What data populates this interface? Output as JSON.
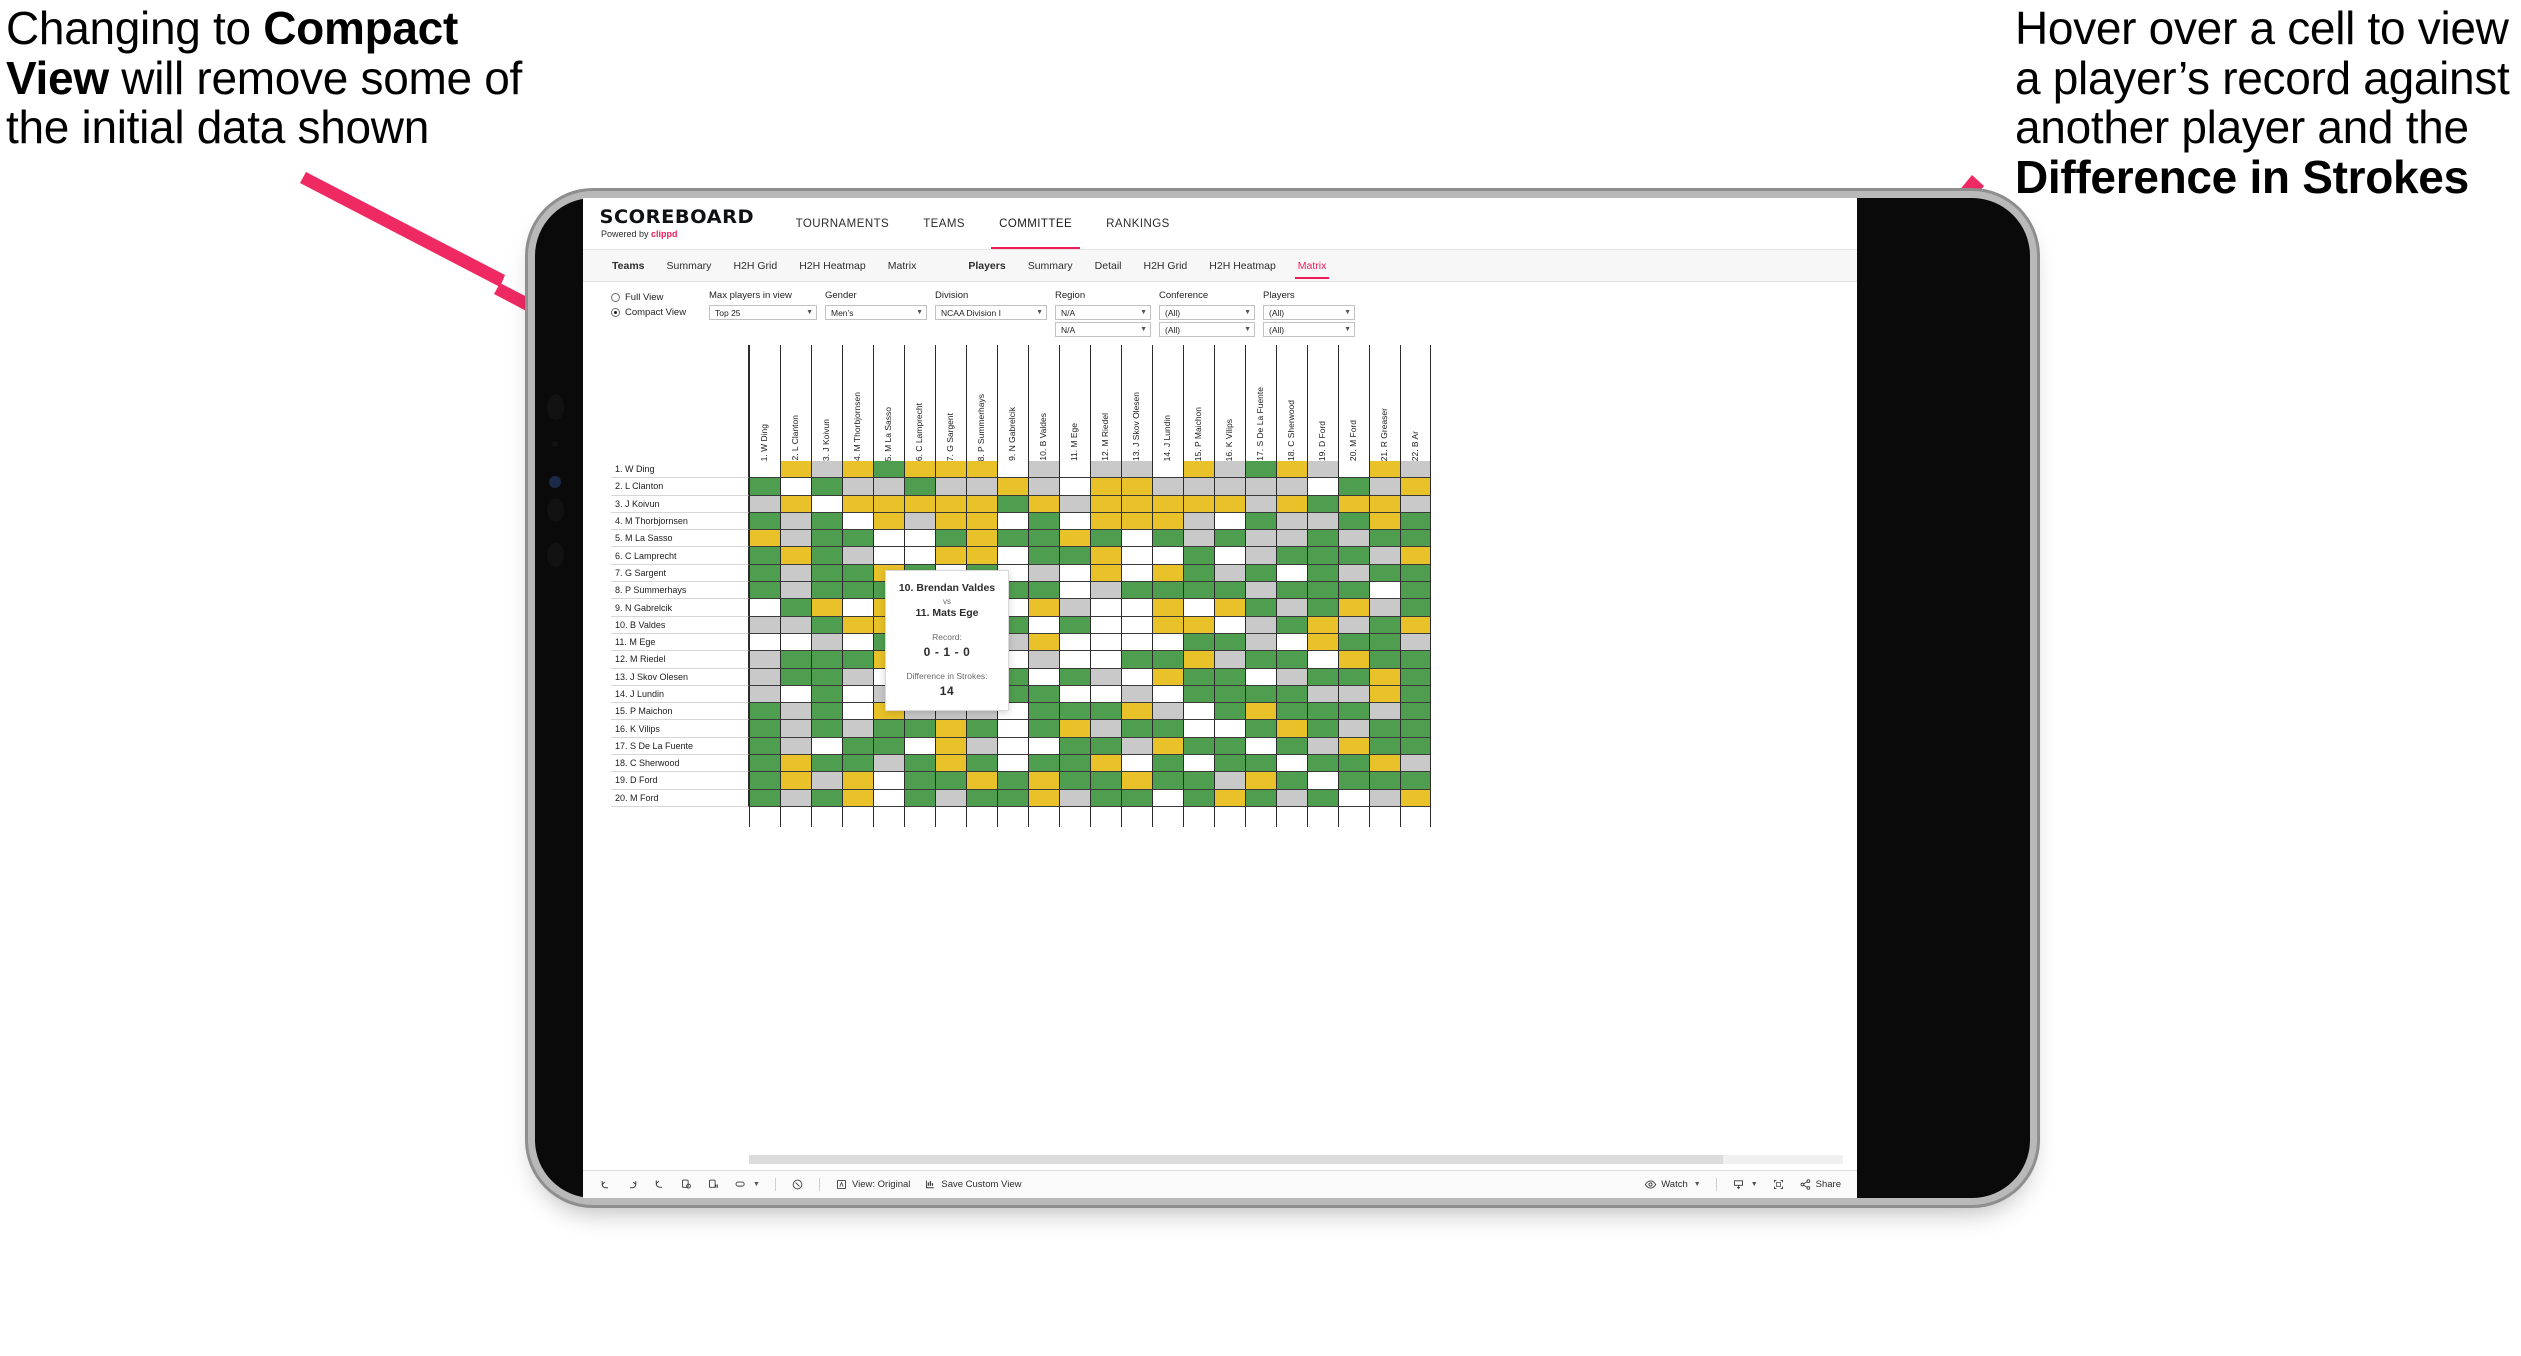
{
  "annotations": {
    "left": {
      "pre": "Changing to ",
      "bold": "Compact View",
      "post": " will remove some of the initial data shown"
    },
    "right": {
      "pre": "Hover over a cell to view a player’s record against another player and the ",
      "bold": "Difference in Strokes",
      "post": ""
    }
  },
  "brand": {
    "name": "SCOREBOARD",
    "powered_by": "Powered by ",
    "clippd": "clippd",
    "accent": "#ee1b5b"
  },
  "topnav": [
    {
      "label": "TOURNAMENTS",
      "active": false
    },
    {
      "label": "TEAMS",
      "active": false
    },
    {
      "label": "COMMITTEE",
      "active": true
    },
    {
      "label": "RANKINGS",
      "active": false
    }
  ],
  "subnav_left": [
    {
      "label": "Teams",
      "bold": true,
      "active": false
    },
    {
      "label": "Summary",
      "bold": false,
      "active": false
    },
    {
      "label": "H2H Grid",
      "bold": false,
      "active": false
    },
    {
      "label": "H2H Heatmap",
      "bold": false,
      "active": false
    },
    {
      "label": "Matrix",
      "bold": false,
      "active": false
    }
  ],
  "subnav_right": [
    {
      "label": "Players",
      "bold": true,
      "active": false
    },
    {
      "label": "Summary",
      "bold": false,
      "active": false
    },
    {
      "label": "Detail",
      "bold": false,
      "active": false
    },
    {
      "label": "H2H Grid",
      "bold": false,
      "active": false
    },
    {
      "label": "H2H Heatmap",
      "bold": false,
      "active": false
    },
    {
      "label": "Matrix",
      "bold": false,
      "active": true
    }
  ],
  "filters": {
    "view_mode": {
      "full_label": "Full View",
      "compact_label": "Compact View",
      "selected": "Compact View"
    },
    "max_players": {
      "label": "Max players in view",
      "value": "Top 25"
    },
    "gender": {
      "label": "Gender",
      "value": "Men’s"
    },
    "division": {
      "label": "Division",
      "value": "NCAA Division I"
    },
    "region": {
      "label": "Region",
      "value": "N/A",
      "value2": "N/A"
    },
    "conference": {
      "label": "Conference",
      "value": "(All)",
      "value2": "(All)"
    },
    "players": {
      "label": "Players",
      "value": "(All)",
      "value2": "(All)"
    }
  },
  "matrix": {
    "row_labels": [
      "1. W Ding",
      "2. L Clanton",
      "3. J Koivun",
      "4. M Thorbjornsen",
      "5. M La Sasso",
      "6. C Lamprecht",
      "7. G Sargent",
      "8. P Summerhays",
      "9. N Gabrelcik",
      "10. B Valdes",
      "11. M Ege",
      "12. M Riedel",
      "13. J Skov Olesen",
      "14. J Lundin",
      "15. P Maichon",
      "16. K Vilips",
      "17. S De La Fuente",
      "18. C Sherwood",
      "19. D Ford",
      "20. M Ford"
    ],
    "column_labels": [
      "1. W Ding",
      "2. L Clanton",
      "3. J Koivun",
      "4. M Thorbjornsen",
      "5. M La Sasso",
      "6. C Lamprecht",
      "7. G Sargent",
      "8. P Summerhays",
      "9. N Gabrelcik",
      "10. B Valdes",
      "11. M Ege",
      "12. M Riedel",
      "13. J Skov Olesen",
      "14. J Lundin",
      "15. P Maichon",
      "16. K Vilips",
      "17. S De La Fuente",
      "18. C Sherwood",
      "19. D Ford",
      "20. M Ford",
      "21. R Greaser",
      "22. B Ar"
    ],
    "legend_colors": {
      "win": "#4f9e4f",
      "loss": "#e9c229",
      "tie": "#c9c9c9",
      "none": "#ffffff",
      "diagonal": "#ffffff"
    },
    "cells": [
      [
        "w",
        "y",
        "a",
        "y",
        "g",
        "y",
        "y",
        "y",
        "w",
        "a",
        "w",
        "a",
        "a",
        "w",
        "y",
        "a",
        "g",
        "y",
        "a",
        "w",
        "y",
        "a"
      ],
      [
        "g",
        "w",
        "g",
        "a",
        "a",
        "g",
        "a",
        "a",
        "y",
        "a",
        "w",
        "y",
        "y",
        "a",
        "a",
        "a",
        "a",
        "a",
        "w",
        "g",
        "a",
        "y"
      ],
      [
        "a",
        "y",
        "w",
        "y",
        "y",
        "y",
        "y",
        "y",
        "g",
        "y",
        "a",
        "y",
        "y",
        "y",
        "y",
        "y",
        "a",
        "y",
        "g",
        "y",
        "y",
        "a"
      ],
      [
        "g",
        "a",
        "g",
        "w",
        "y",
        "a",
        "y",
        "y",
        "w",
        "g",
        "w",
        "y",
        "y",
        "y",
        "a",
        "w",
        "g",
        "a",
        "a",
        "g",
        "y",
        "g"
      ],
      [
        "y",
        "a",
        "g",
        "g",
        "w",
        "w",
        "g",
        "y",
        "g",
        "g",
        "y",
        "g",
        "w",
        "g",
        "a",
        "g",
        "a",
        "a",
        "g",
        "a",
        "g",
        "g"
      ],
      [
        "g",
        "y",
        "g",
        "a",
        "w",
        "w",
        "y",
        "y",
        "w",
        "g",
        "g",
        "y",
        "w",
        "w",
        "g",
        "w",
        "a",
        "g",
        "g",
        "g",
        "a",
        "y"
      ],
      [
        "g",
        "a",
        "g",
        "g",
        "y",
        "g",
        "w",
        "g",
        "w",
        "a",
        "w",
        "y",
        "w",
        "y",
        "g",
        "a",
        "g",
        "w",
        "g",
        "a",
        "g",
        "g"
      ],
      [
        "g",
        "a",
        "g",
        "g",
        "g",
        "g",
        "y",
        "w",
        "g",
        "g",
        "w",
        "a",
        "g",
        "g",
        "g",
        "g",
        "a",
        "g",
        "g",
        "g",
        "w",
        "g"
      ],
      [
        "w",
        "g",
        "y",
        "w",
        "y",
        "w",
        "w",
        "y",
        "w",
        "y",
        "a",
        "w",
        "w",
        "y",
        "w",
        "y",
        "g",
        "a",
        "g",
        "y",
        "a",
        "g"
      ],
      [
        "a",
        "a",
        "g",
        "y",
        "y",
        "y",
        "a",
        "a",
        "g",
        "w",
        "g",
        "w",
        "w",
        "y",
        "y",
        "w",
        "a",
        "g",
        "y",
        "a",
        "g",
        "y"
      ],
      [
        "w",
        "w",
        "a",
        "w",
        "g",
        "y",
        "w",
        "w",
        "a",
        "y",
        "w",
        "w",
        "w",
        "w",
        "g",
        "g",
        "a",
        "w",
        "y",
        "g",
        "g",
        "a"
      ],
      [
        "a",
        "g",
        "g",
        "g",
        "y",
        "g",
        "g",
        "a",
        "w",
        "a",
        "w",
        "w",
        "g",
        "g",
        "y",
        "a",
        "g",
        "g",
        "w",
        "y",
        "g",
        "g"
      ],
      [
        "a",
        "g",
        "g",
        "a",
        "w",
        "y",
        "a",
        "y",
        "g",
        "w",
        "g",
        "a",
        "w",
        "y",
        "g",
        "g",
        "w",
        "a",
        "g",
        "g",
        "y",
        "g"
      ],
      [
        "a",
        "w",
        "g",
        "w",
        "a",
        "w",
        "g",
        "y",
        "g",
        "g",
        "w",
        "w",
        "a",
        "w",
        "g",
        "g",
        "g",
        "g",
        "a",
        "a",
        "y",
        "g"
      ],
      [
        "g",
        "a",
        "g",
        "w",
        "y",
        "a",
        "a",
        "a",
        "w",
        "g",
        "g",
        "g",
        "y",
        "a",
        "w",
        "g",
        "y",
        "g",
        "g",
        "g",
        "a",
        "g"
      ],
      [
        "g",
        "a",
        "g",
        "a",
        "g",
        "g",
        "y",
        "g",
        "w",
        "g",
        "y",
        "a",
        "g",
        "g",
        "w",
        "w",
        "g",
        "y",
        "g",
        "a",
        "g",
        "g"
      ],
      [
        "g",
        "a",
        "w",
        "g",
        "g",
        "w",
        "y",
        "a",
        "w",
        "w",
        "g",
        "g",
        "a",
        "y",
        "g",
        "g",
        "w",
        "g",
        "a",
        "y",
        "g",
        "g"
      ],
      [
        "g",
        "y",
        "g",
        "g",
        "a",
        "g",
        "y",
        "g",
        "w",
        "g",
        "g",
        "y",
        "w",
        "g",
        "w",
        "g",
        "g",
        "w",
        "g",
        "g",
        "y",
        "a"
      ],
      [
        "g",
        "y",
        "a",
        "y",
        "w",
        "g",
        "g",
        "y",
        "g",
        "y",
        "g",
        "g",
        "y",
        "g",
        "g",
        "a",
        "y",
        "g",
        "w",
        "g",
        "g",
        "g"
      ],
      [
        "g",
        "a",
        "g",
        "y",
        "w",
        "g",
        "a",
        "g",
        "g",
        "y",
        "a",
        "g",
        "g",
        "w",
        "g",
        "y",
        "g",
        "a",
        "g",
        "w",
        "a",
        "y"
      ]
    ]
  },
  "tooltip": {
    "player_a": "10. Brendan Valdes",
    "vs": "vs",
    "player_b": "11. Mats Ege",
    "record_label": "Record:",
    "record_value": "0 - 1 - 0",
    "strokes_label": "Difference in Strokes:",
    "strokes_value": "14"
  },
  "toolbar": {
    "undo": "undo-icon",
    "redo": "redo-icon",
    "revert": "revert-icon",
    "refresh": "refresh-data-icon",
    "pause": "pause-updates-icon",
    "highlight": "highlight-icon",
    "help": "help-icon",
    "view_label": "View: Original",
    "save_label": "Save Custom View",
    "watch_label": "Watch",
    "download": "download-icon",
    "fullscreen": "fullscreen-icon",
    "share_label": "Share"
  }
}
